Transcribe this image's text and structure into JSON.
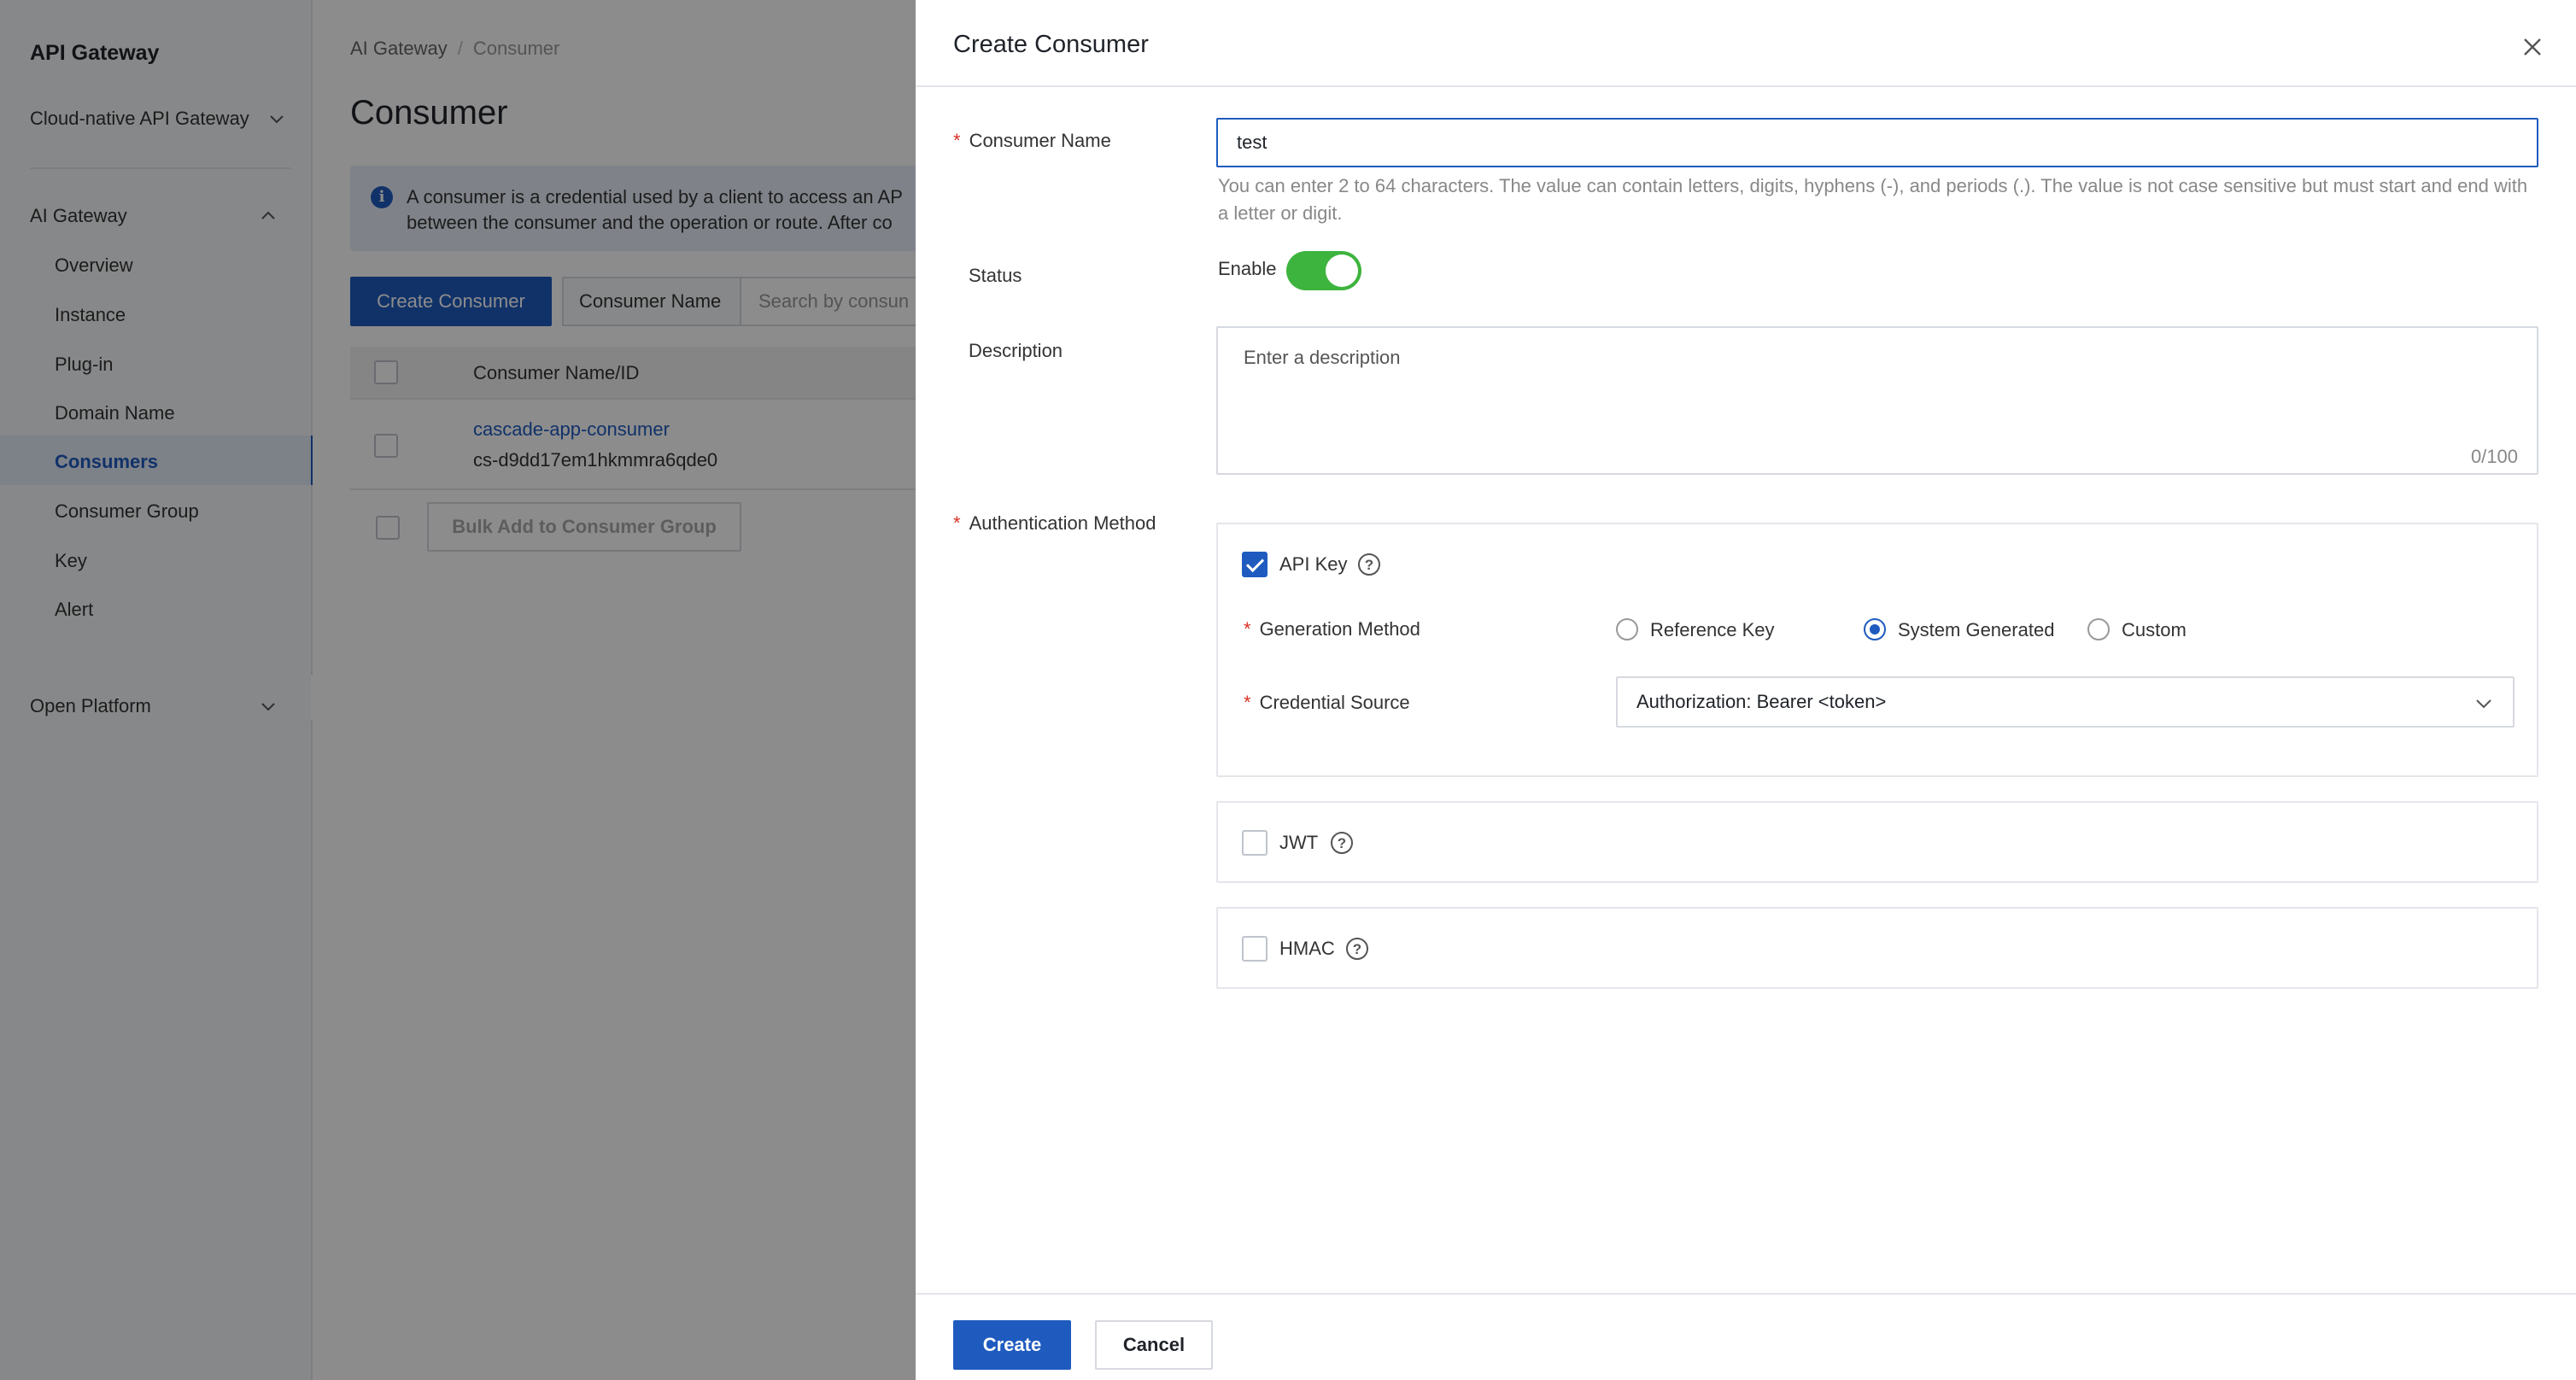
{
  "sidebar": {
    "title": "API Gateway",
    "product": "Cloud-native API Gateway",
    "groups": [
      {
        "label": "AI Gateway"
      },
      {
        "label": "Open Platform"
      }
    ],
    "items": [
      {
        "label": "Overview"
      },
      {
        "label": "Instance"
      },
      {
        "label": "Plug-in"
      },
      {
        "label": "Domain Name"
      },
      {
        "label": "Consumers"
      },
      {
        "label": "Consumer Group"
      },
      {
        "label": "Key"
      },
      {
        "label": "Alert"
      }
    ]
  },
  "page": {
    "breadcrumb": [
      "AI Gateway",
      "Consumer"
    ],
    "title": "Consumer",
    "info_line1": "A consumer is a credential used by a client to access an AP",
    "info_line2": "between the consumer and the operation or route. After co",
    "create_button": "Create Consumer",
    "filter_field": "Consumer Name",
    "search_placeholder": "Search by consun",
    "table_header": "Consumer Name/ID",
    "rows": [
      {
        "name": "cascade-app-consumer",
        "id": "cs-d9dd17em1hkmmra6qde0"
      }
    ],
    "bulk_button": "Bulk Add to Consumer Group"
  },
  "drawer": {
    "title": "Create Consumer",
    "name_label": "Consumer Name",
    "name_value": "test",
    "name_hint": "You can enter 2 to 64 characters. The value can contain letters, digits, hyphens (-), and periods (.). The value is not case sensitive but must start and end with a letter or digit.",
    "status_label": "Status",
    "status_value": "Enable",
    "status_enabled": true,
    "description_label": "Description",
    "description_placeholder": "Enter a description",
    "description_count": "0/100",
    "auth_label": "Authentication Method",
    "auth_methods": [
      {
        "name": "API Key",
        "checked": true
      },
      {
        "name": "JWT",
        "checked": false
      },
      {
        "name": "HMAC",
        "checked": false
      }
    ],
    "generation_label": "Generation Method",
    "generation_options": [
      "Reference Key",
      "System Generated",
      "Custom"
    ],
    "generation_selected": "System Generated",
    "credential_label": "Credential Source",
    "credential_value": "Authorization: Bearer <token>",
    "create_button": "Create",
    "cancel_button": "Cancel"
  },
  "colors": {
    "primary": "#1f5bbf",
    "toggle_on": "#3db43d",
    "required": "#d93026"
  }
}
